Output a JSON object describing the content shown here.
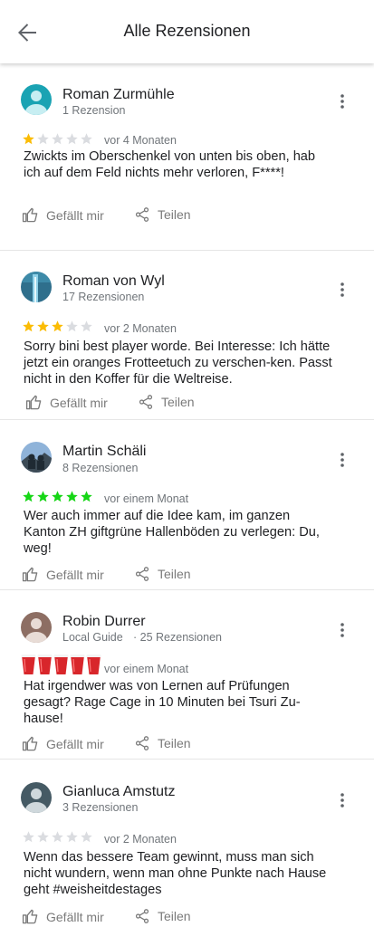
{
  "header": {
    "title": "Alle Rezensionen",
    "back_icon": "arrow-back-icon"
  },
  "actions": {
    "like_label": "Gefällt mir",
    "share_label": "Teilen"
  },
  "colors": {
    "star_gold": "#fbbc04",
    "star_gray": "#dadce0",
    "star_green": "#16d616",
    "muted_text": "#70757a",
    "cup_red": "#d8262b"
  },
  "reviews": [
    {
      "author": "Roman Zurmühle",
      "subtitle": "1 Rezension",
      "rating": 1,
      "date": "vor 4 Monaten",
      "text": "Zwickts im Oberschenkel von unten bis oben, hab ich auf dem Feld nichts mehr verloren, F****!",
      "avatar": "default-avatar-icon"
    },
    {
      "author": "Roman von Wyl",
      "subtitle": "17 Rezensionen",
      "rating": 3,
      "date": "vor 2 Monaten",
      "text": "Sorry bini best player worde. Bei Interesse: Ich hätte jetzt ein oranges Frotteetuch zu verschen-ken. Passt nicht in den Koffer für die Weltreise.",
      "avatar": "photo-avatar"
    },
    {
      "author": "Martin Schäli",
      "subtitle": "8 Rezensionen",
      "rating": 5,
      "date": "vor einem Monat",
      "text": "Wer auch immer auf die Idee kam, im ganzen Kanton ZH giftgrüne Hallenböden zu verlegen: Du, weg!",
      "avatar": "photo-avatar"
    },
    {
      "author": "Robin Durrer",
      "subtitle_badge": "Local Guide",
      "subtitle": "· 25 Rezensionen",
      "rating": 5,
      "date": "vor einem Monat",
      "text": "Hat irgendwer was von Lernen auf Prüfungen gesagt? Rage Cage in 10 Minuten bei Tsuri Zu-hause!",
      "avatar": "default-avatar-icon"
    },
    {
      "author": "Gianluca Amstutz",
      "subtitle": "3 Rezensionen",
      "rating": 0,
      "date": "vor 2 Monaten",
      "text": "Wenn das bessere Team gewinnt, muss man sich nicht wundern, wenn man ohne Punkte nach Hause geht #weisheitdestages",
      "avatar": "default-avatar-icon"
    }
  ]
}
